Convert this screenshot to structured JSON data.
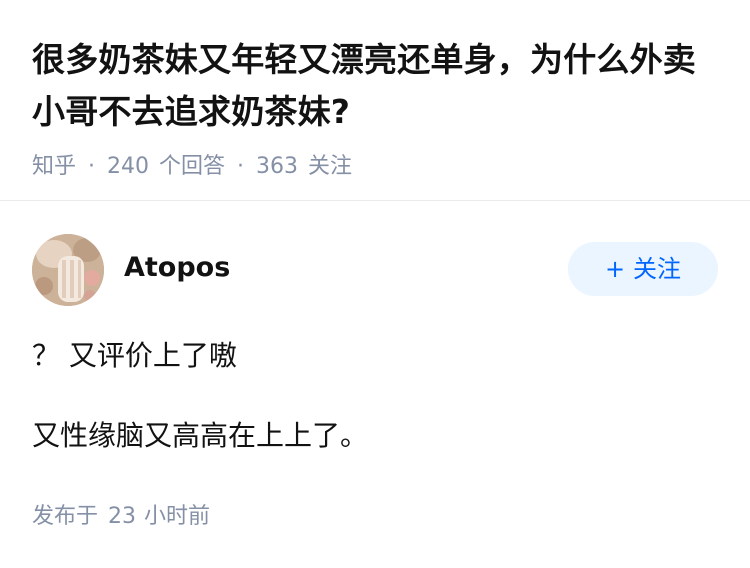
{
  "question": {
    "title": "很多奶茶妹又年轻又漂亮还单身，为什么外卖小哥不去追求奶茶妹?",
    "source": "知乎",
    "answer_count": "240",
    "answer_label": "个回答",
    "follower_count": "363",
    "follower_label": "关注",
    "separator": "·"
  },
  "answer": {
    "author_name": "Atopos",
    "follow_button": {
      "icon_text": "+",
      "label": "关注"
    },
    "paragraphs": [
      "？ 又评价上了嗷",
      "又性缘脑又高高在上上了。"
    ],
    "published_label": "发布于",
    "published_value": "23",
    "published_unit": "小时前"
  },
  "colors": {
    "text_primary": "#121212",
    "text_meta": "#8590a6",
    "brand_blue": "#0066ff",
    "button_bg": "#ebf5ff",
    "divider": "#ebebeb"
  },
  "icons": {
    "follow_plus": "plus-icon"
  }
}
